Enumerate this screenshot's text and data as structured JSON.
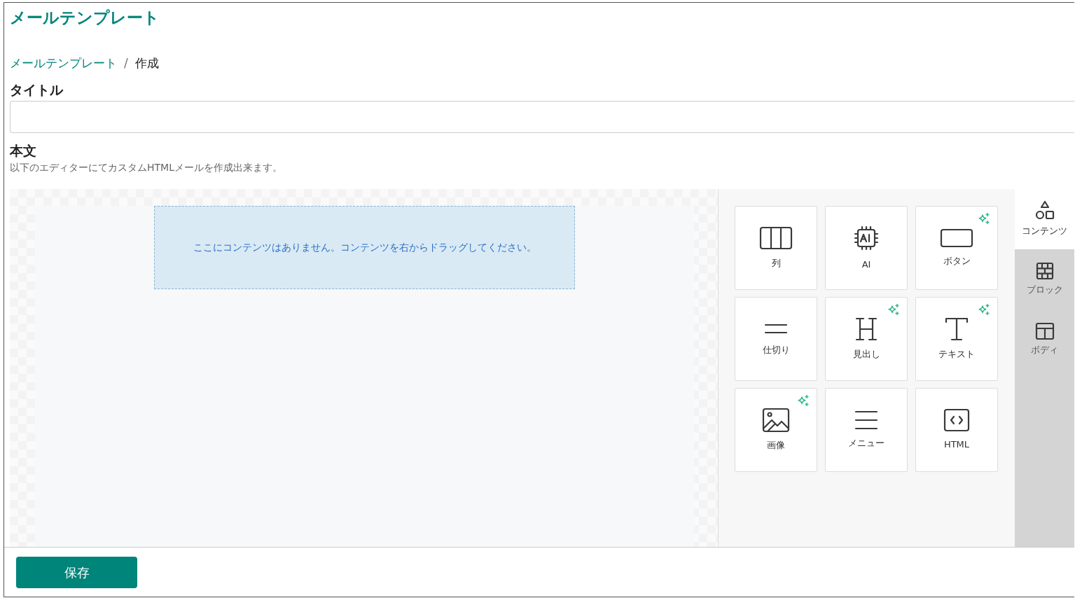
{
  "page_title": "メールテンプレート",
  "breadcrumb_separator": "/",
  "breadcrumb": [
    {
      "label": "メールテンプレート",
      "link": true
    },
    {
      "label": "作成",
      "link": false
    }
  ],
  "title_field": {
    "label": "タイトル"
  },
  "body_field": {
    "label": "本文",
    "description": "以下のエディターにてカスタムHTMLメールを作成出来ます。"
  },
  "editor": {
    "empty_message": "ここにコンテンツはありません。コンテンツを右からドラッグしてください。",
    "tools": [
      {
        "kind": "columns",
        "label": "列",
        "ai": false
      },
      {
        "kind": "ai",
        "label": "AI",
        "ai": false
      },
      {
        "kind": "button",
        "label": "ボタン",
        "ai": true
      },
      {
        "kind": "divider",
        "label": "仕切り",
        "ai": false
      },
      {
        "kind": "heading",
        "label": "見出し",
        "ai": true
      },
      {
        "kind": "text",
        "label": "テキスト",
        "ai": true
      },
      {
        "kind": "image",
        "label": "画像",
        "ai": true
      },
      {
        "kind": "menu",
        "label": "メニュー",
        "ai": false
      },
      {
        "kind": "html",
        "label": "HTML",
        "ai": false
      }
    ],
    "tabs": [
      {
        "kind": "content",
        "label": "コンテンツ",
        "selected": true
      },
      {
        "kind": "blocks",
        "label": "ブロック",
        "selected": false
      },
      {
        "kind": "body",
        "label": "ボディ",
        "selected": false
      }
    ]
  },
  "save_button": "保存"
}
